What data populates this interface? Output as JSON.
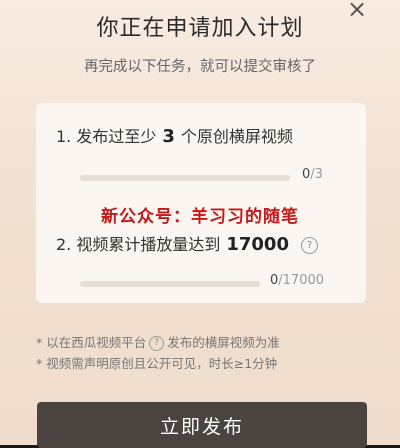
{
  "modal": {
    "title": "你正在申请加入计划",
    "subtitle": "再完成以下任务，就可以提交审核了",
    "close_icon": "×"
  },
  "tasks": [
    {
      "prefix": "1. 发布过至少",
      "number": "3",
      "suffix": "个原创横屏视频",
      "progress_current": "0",
      "progress_total": "/3",
      "progress_fraction": 0
    },
    {
      "prefix": "2. 视频累计播放量达到",
      "number": "17000",
      "suffix": "",
      "help_icon": "?",
      "progress_current": "0",
      "progress_total": "/17000",
      "progress_fraction": 0
    }
  ],
  "watermark": "新公众号：羊习习的随笔",
  "notes": {
    "line1_a": "* 以在西瓜视频平台",
    "line1_help": "?",
    "line1_b": "发布的横屏视频为准",
    "line2": "* 视频需声明原创且公开可见，时长≥1分钟"
  },
  "primary_button": "立即发布",
  "colors": {
    "accent": "#ff5a3c",
    "button_bg": "#4a4340",
    "watermark": "#c41a1a"
  }
}
